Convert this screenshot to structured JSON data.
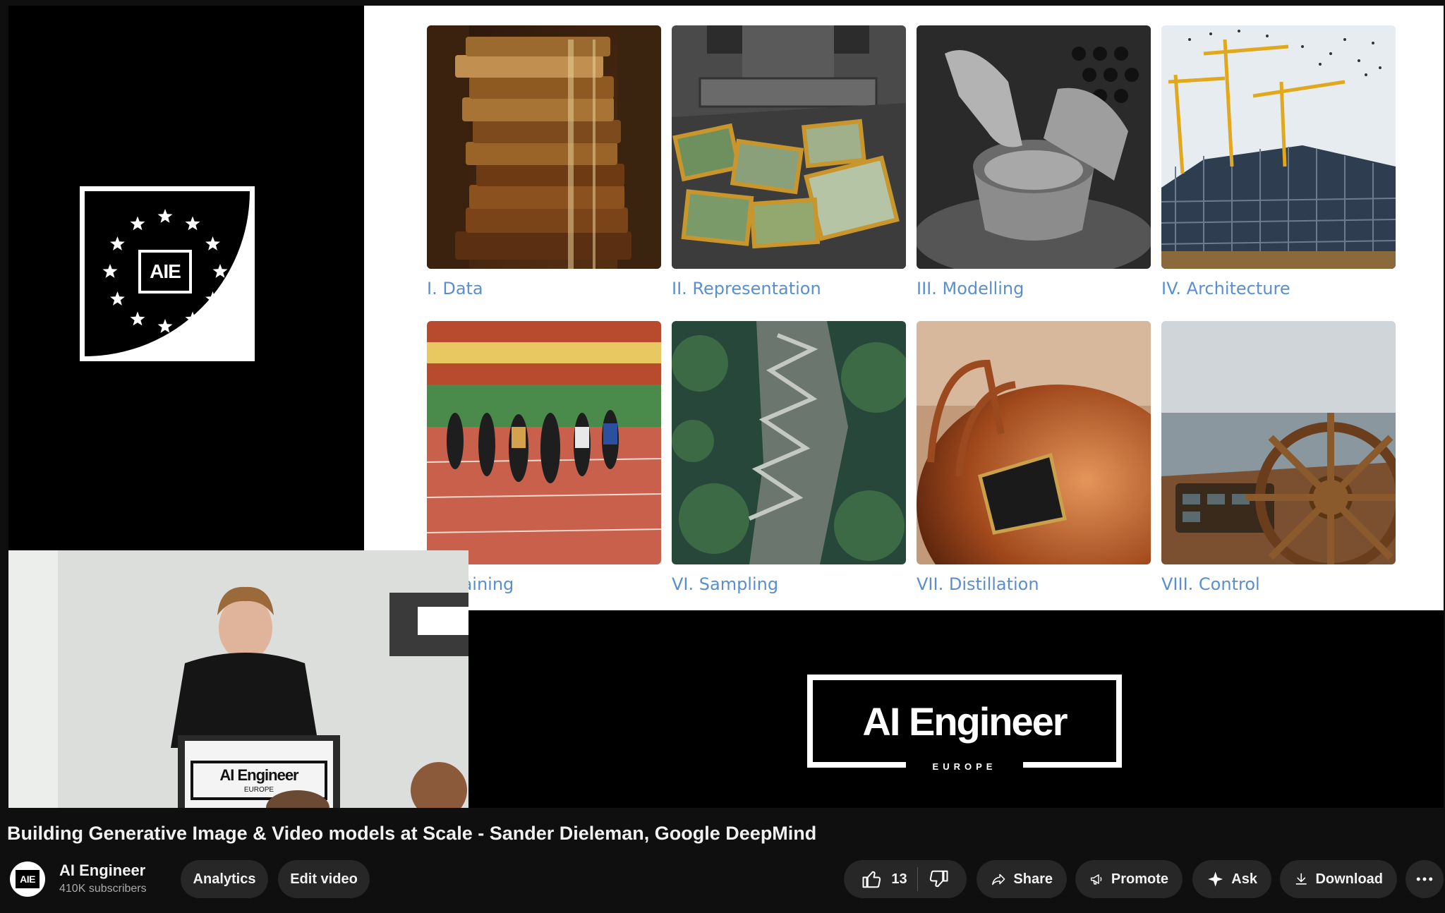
{
  "slide": {
    "tiles": [
      {
        "caption": "I. Data",
        "image": "stacked-books-photo"
      },
      {
        "caption": "II. Representation",
        "image": "compressed-photo-frames-photo"
      },
      {
        "caption": "III. Modelling",
        "image": "pottery-wheel-photo"
      },
      {
        "caption": "IV. Architecture",
        "image": "construction-cranes-photo"
      },
      {
        "caption": "V. Training",
        "image": "sprinters-photo"
      },
      {
        "caption": "VI. Sampling",
        "image": "winding-mountain-path-photo"
      },
      {
        "caption": "VII. Distillation",
        "image": "copper-still-photo"
      },
      {
        "caption": "VIII. Control",
        "image": "ship-wheel-photo"
      }
    ]
  },
  "brand": {
    "badge_text": "AIE",
    "logo_text": "AI Engineer",
    "logo_sub": "EUROPE",
    "podium_text": "AI Engineer",
    "podium_sub": "EUROPE"
  },
  "video": {
    "title": "Building Generative Image & Video models at Scale - Sander Dieleman, Google DeepMind"
  },
  "channel": {
    "avatar_text": "AIE",
    "name": "AI Engineer",
    "subscribers": "410K subscribers"
  },
  "actions": {
    "analytics": "Analytics",
    "edit_video": "Edit video",
    "likes": "13",
    "share": "Share",
    "promote": "Promote",
    "ask": "Ask",
    "download": "Download"
  },
  "colors": {
    "caption": "#5a8fcf",
    "pill_bg": "#272727",
    "page_bg": "#0f0f0f"
  }
}
